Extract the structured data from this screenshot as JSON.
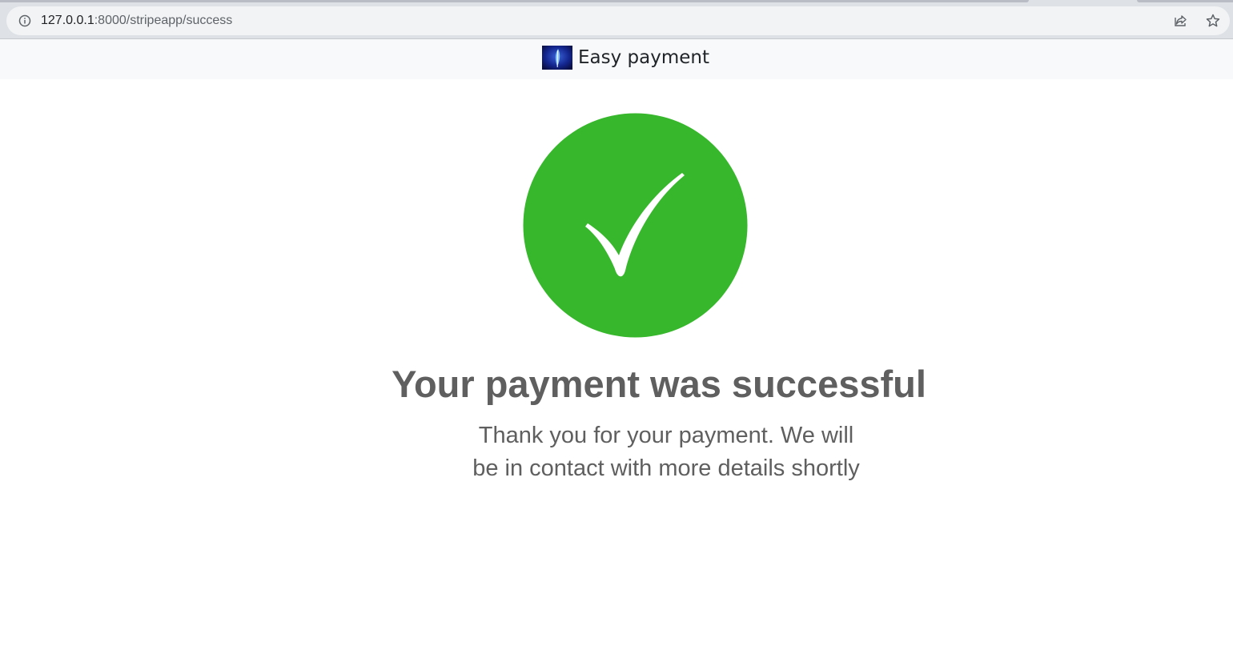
{
  "browser": {
    "url_host": "127.0.0.1",
    "url_path": ":8000/stripeapp/success",
    "icons": {
      "site_info": "info-icon",
      "share": "share-icon",
      "bookmark": "star-icon"
    }
  },
  "navbar": {
    "brand_text": "Easy payment",
    "brand_logo": "feather-logo"
  },
  "main": {
    "status_icon": "checkmark-icon",
    "status_color": "#37b72c",
    "headline": "Your payment was successful",
    "message_line1": "Thank you for your payment. We will",
    "message_line2": "be in contact with more details shortly"
  }
}
